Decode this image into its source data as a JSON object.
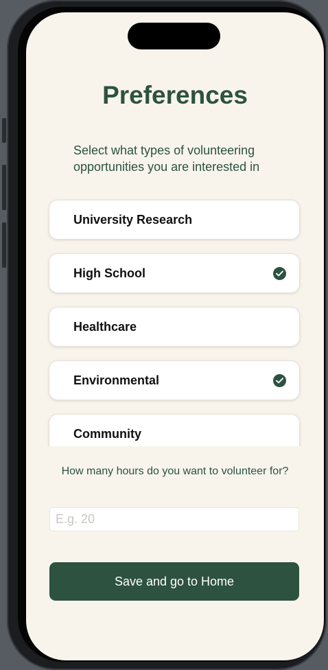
{
  "screen": {
    "title": "Preferences",
    "subtitle": "Select what types of volunteering opportunities you are interested in"
  },
  "opportunities": [
    {
      "label": "University Research",
      "selected": false
    },
    {
      "label": "High School",
      "selected": true
    },
    {
      "label": "Healthcare",
      "selected": false
    },
    {
      "label": "Environmental",
      "selected": true
    },
    {
      "label": "Community",
      "selected": false
    }
  ],
  "hours": {
    "question": "How many hours do you want to volunteer for?",
    "value": "",
    "placeholder": "E.g. 20"
  },
  "actions": {
    "save_label": "Save and go to Home"
  },
  "colors": {
    "accent": "#2d5240",
    "background": "#f8f4ec"
  },
  "icons": {
    "selected": "checkmark-circle-icon"
  }
}
